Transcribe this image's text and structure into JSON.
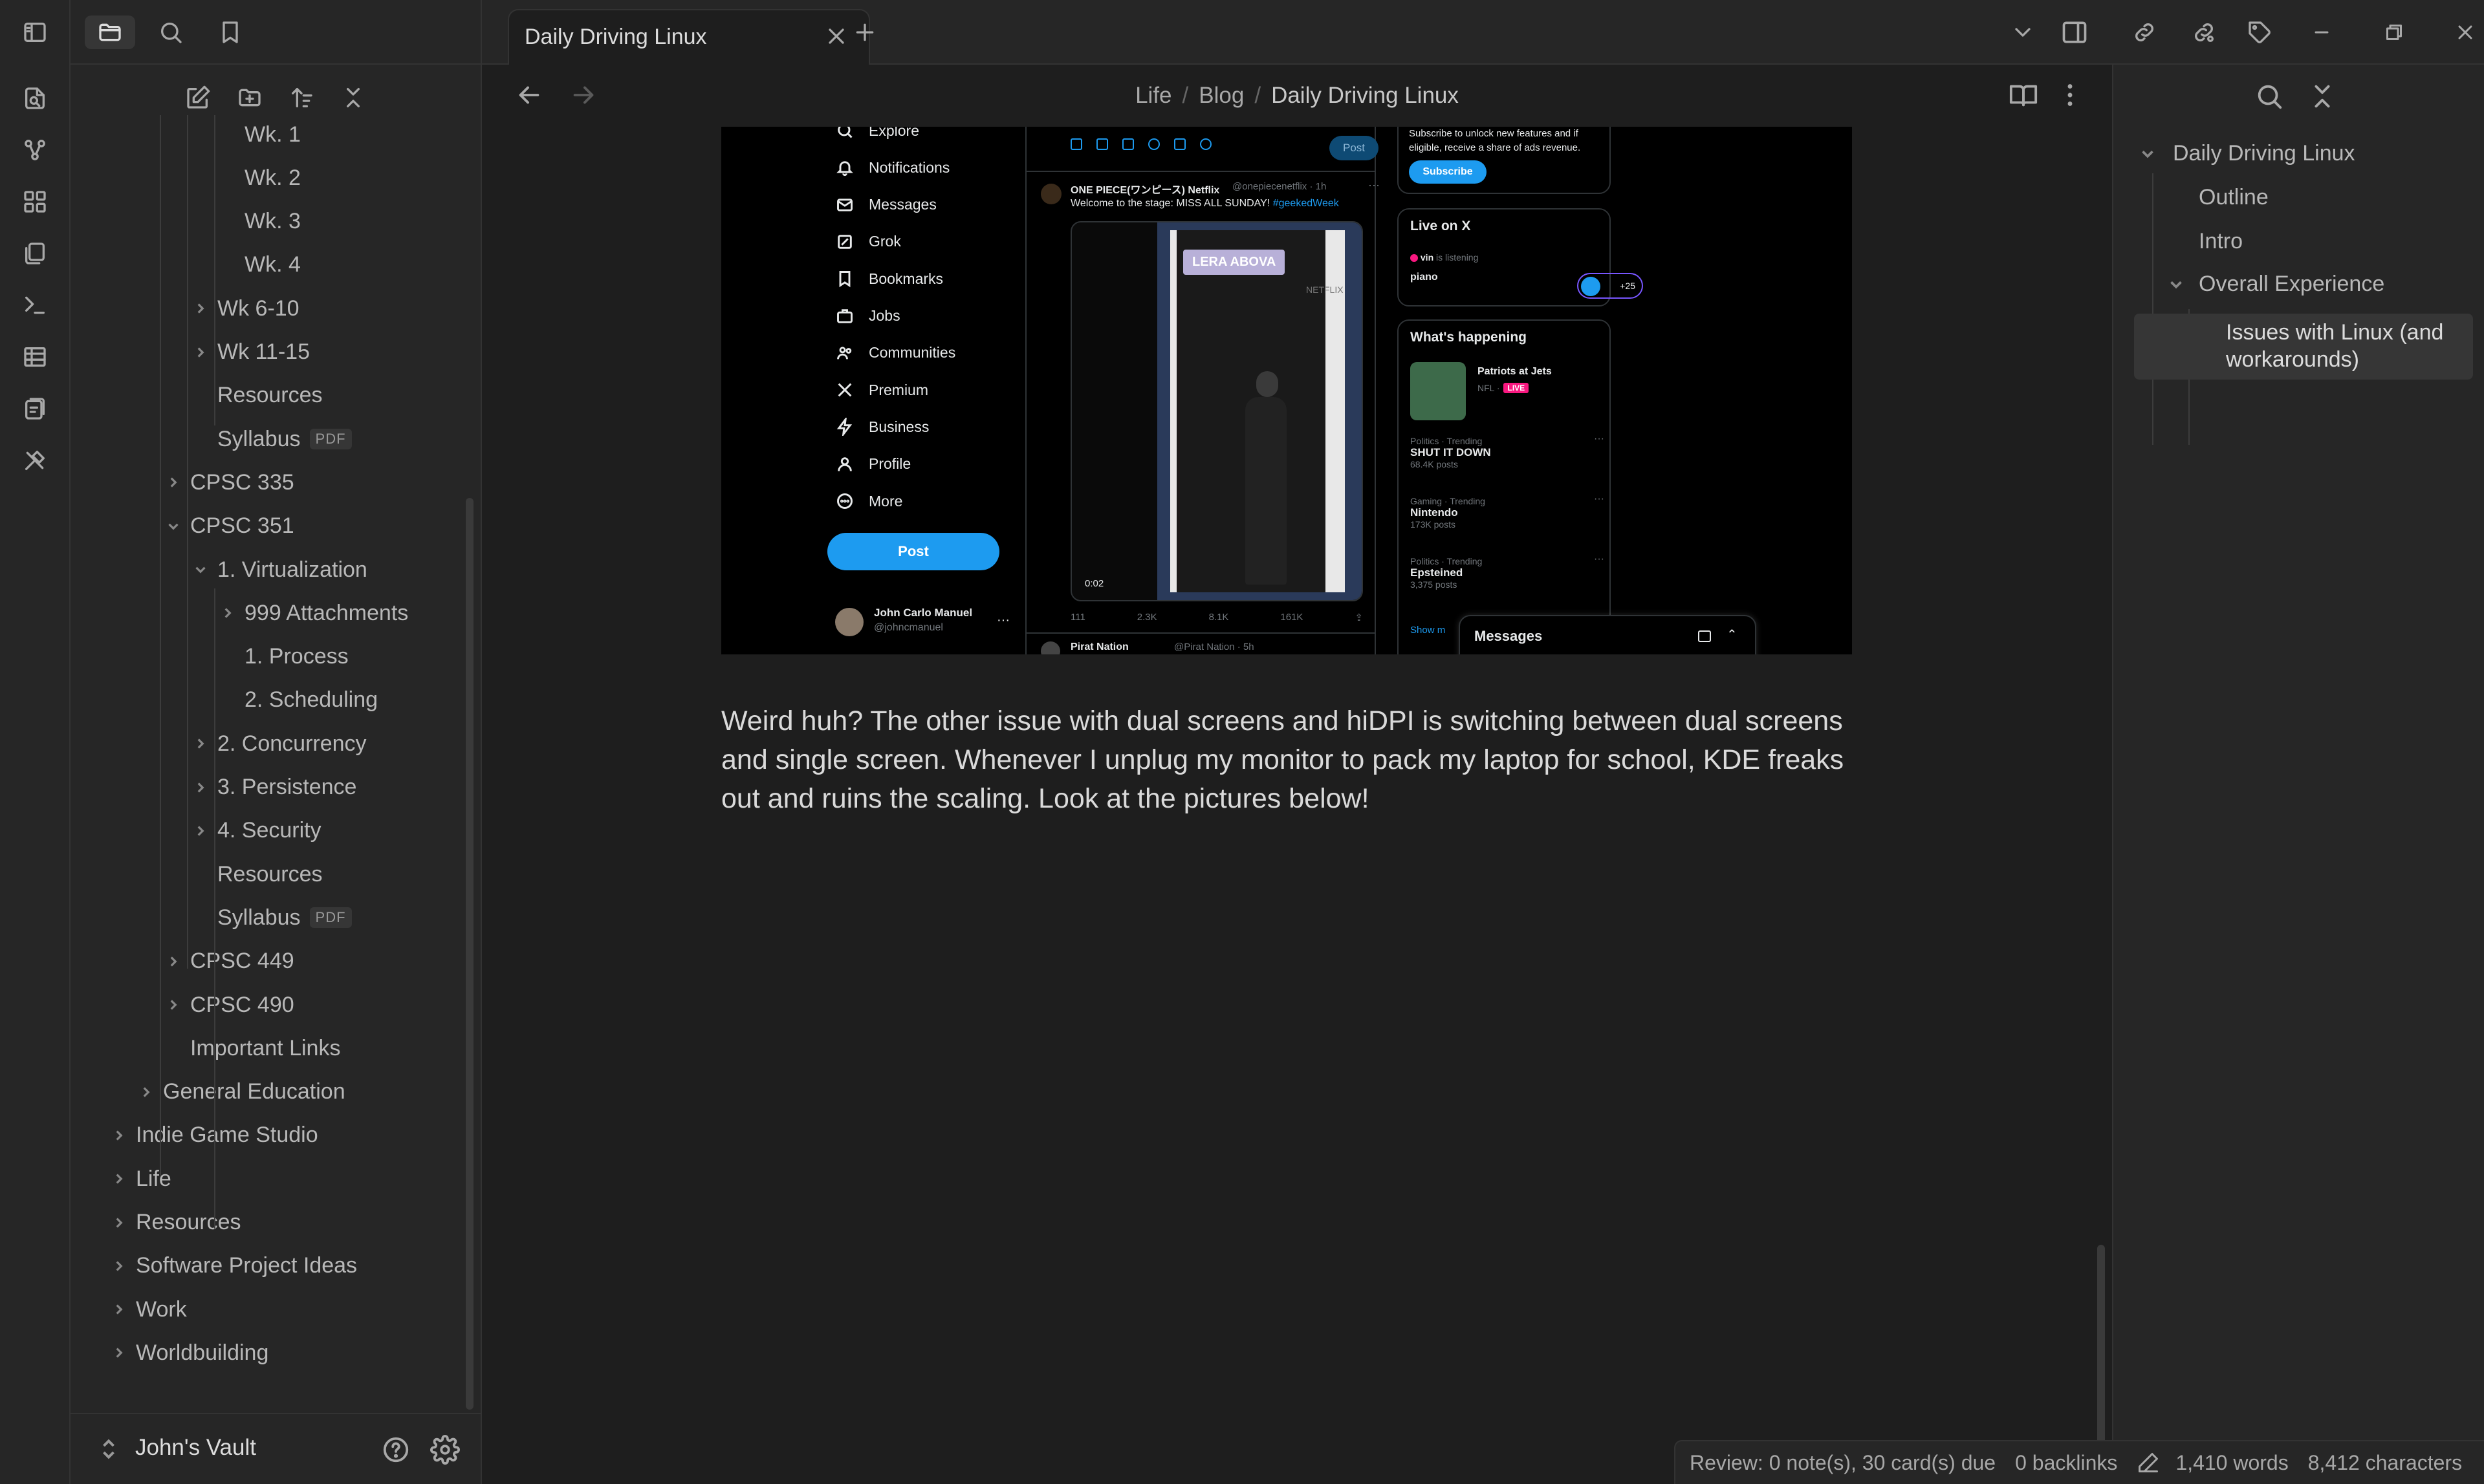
{
  "ribbon": {
    "icons": [
      "sidebar-toggle-icon",
      "open-quick-switcher-icon",
      "graph-view-icon",
      "canvas-icon",
      "templates-icon",
      "terminal-icon",
      "table-icon",
      "flashcards-icon",
      "excalidraw-icon"
    ]
  },
  "left_tabs": [
    "files-icon",
    "search-icon",
    "bookmarks-icon"
  ],
  "file_tree": [
    {
      "label": "Wk. 1",
      "depth": 3,
      "chevron": "none"
    },
    {
      "label": "Wk. 2",
      "depth": 3,
      "chevron": "none"
    },
    {
      "label": "Wk. 3",
      "depth": 3,
      "chevron": "none"
    },
    {
      "label": "Wk. 4",
      "depth": 3,
      "chevron": "none"
    },
    {
      "label": "Wk 6-10",
      "depth": 2,
      "chevron": "right"
    },
    {
      "label": "Wk 11-15",
      "depth": 2,
      "chevron": "right"
    },
    {
      "label": "Resources",
      "depth": 2,
      "chevron": "none"
    },
    {
      "label": "Syllabus",
      "depth": 2,
      "chevron": "none",
      "badge": "PDF"
    },
    {
      "label": "CPSC 335",
      "depth": 1,
      "chevron": "right"
    },
    {
      "label": "CPSC 351",
      "depth": 1,
      "chevron": "down"
    },
    {
      "label": "1. Virtualization",
      "depth": 2,
      "chevron": "down"
    },
    {
      "label": "999 Attachments",
      "depth": 3,
      "chevron": "right"
    },
    {
      "label": "1. Process",
      "depth": 3,
      "chevron": "none"
    },
    {
      "label": "2. Scheduling",
      "depth": 3,
      "chevron": "none"
    },
    {
      "label": "2. Concurrency",
      "depth": 2,
      "chevron": "right"
    },
    {
      "label": "3. Persistence",
      "depth": 2,
      "chevron": "right"
    },
    {
      "label": "4. Security",
      "depth": 2,
      "chevron": "right"
    },
    {
      "label": "Resources",
      "depth": 2,
      "chevron": "none"
    },
    {
      "label": "Syllabus",
      "depth": 2,
      "chevron": "none",
      "badge": "PDF"
    },
    {
      "label": "CPSC 449",
      "depth": 1,
      "chevron": "right"
    },
    {
      "label": "CPSC 490",
      "depth": 1,
      "chevron": "right"
    },
    {
      "label": "Important Links",
      "depth": 1,
      "chevron": "none"
    },
    {
      "label": "General Education",
      "depth": 0,
      "chevron": "right"
    },
    {
      "label": "Indie Game Studio",
      "depth": -1,
      "chevron": "right"
    },
    {
      "label": "Life",
      "depth": -1,
      "chevron": "right"
    },
    {
      "label": "Resources",
      "depth": -1,
      "chevron": "right"
    },
    {
      "label": "Software Project Ideas",
      "depth": -1,
      "chevron": "right"
    },
    {
      "label": "Work",
      "depth": -1,
      "chevron": "right"
    },
    {
      "label": "Worldbuilding",
      "depth": -1,
      "chevron": "right"
    }
  ],
  "vault": {
    "name": "John's Vault"
  },
  "tab": {
    "title": "Daily Driving Linux"
  },
  "breadcrumb": {
    "part1": "Life",
    "part2": "Blog",
    "current": "Daily Driving Linux",
    "sep": "/"
  },
  "editor": {
    "paragraph": "Weird huh? The other issue with dual screens and hiDPI is switching between dual screens and single screen. Whenever I unplug my monitor to pack my laptop for school, KDE freaks out and ruins the scaling. Look at the pictures below!"
  },
  "embed": {
    "menu": [
      "Explore",
      "Notifications",
      "Messages",
      "Grok",
      "Bookmarks",
      "Jobs",
      "Communities",
      "Premium",
      "Business",
      "Profile",
      "More"
    ],
    "menu_icons": [
      "search-icon",
      "bell-icon",
      "mail-icon",
      "grok-icon",
      "bookmark-icon",
      "briefcase-icon",
      "people-icon",
      "x-logo-icon",
      "lightning-icon",
      "person-icon",
      "more-circle-icon"
    ],
    "post_button": "Post",
    "user_name": "John Carlo Manuel",
    "user_handle": "@johncmanuel",
    "compose_post": "Post",
    "tweet1_author": "ONE PIECE(ワンピース) Netflix",
    "tweet1_handle": "@onepiecenetflix · 1h",
    "tweet1_text": "Welcome to the stage: MISS ALL SUNDAY!",
    "tweet1_hashtag": "#geekedWeek",
    "video_label": "LERA ABOVA",
    "video_netflix": "NETFLIX",
    "video_time": "0:02",
    "stats": [
      "111",
      "2.3K",
      "8.1K",
      "161K"
    ],
    "tweet2_author": "Pirat Nation",
    "tweet2_handle": "@Pirat Nation · 5h",
    "premium_text_1": "Subscribe to unlock new features and if",
    "premium_text_2": "eligible, receive a share of ads revenue.",
    "subscribe": "Subscribe",
    "live_title": "Live on X",
    "live_user": "vin",
    "live_status": "is listening",
    "live_topic": "piano",
    "live_count": "+25",
    "happening_title": "What's happening",
    "event_title": "Patriots at Jets",
    "event_league": "NFL ·",
    "event_live": "LIVE",
    "trends": [
      {
        "category": "Politics · Trending",
        "name": "SHUT IT DOWN",
        "count": "68.4K posts"
      },
      {
        "category": "Gaming · Trending",
        "name": "Nintendo",
        "count": "173K posts"
      },
      {
        "category": "Politics · Trending",
        "name": "Epsteined",
        "count": "3,375 posts"
      }
    ],
    "show_more": "Show m",
    "messages_title": "Messages",
    "colors": {
      "x_blue": "#1d9bf0",
      "live_pink": "#f91880"
    }
  },
  "outline": {
    "title": "Daily Driving Linux",
    "items": [
      "Outline",
      "Intro",
      "Overall Experience",
      "Issues with Linux (and workarounds)"
    ]
  },
  "status": {
    "review": "Review: 0 note(s), 30 card(s) due",
    "backlinks": "0 backlinks",
    "words": "1,410 words",
    "characters": "8,412 characters"
  },
  "colors": {
    "bg": "#1e1e1e",
    "sidebar": "#262626",
    "text": "#dcddde",
    "muted": "#a8a8a8"
  }
}
